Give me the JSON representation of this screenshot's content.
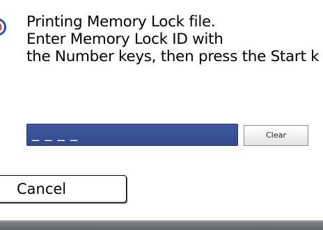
{
  "dialog": {
    "message_lines": [
      "Printing Memory Lock file.",
      "Enter Memory Lock ID with",
      "the Number keys, then press the Start k"
    ]
  },
  "id_field": {
    "mask": "_ _ _ _"
  },
  "buttons": {
    "clear_label": "Clear",
    "cancel_label": "Cancel"
  },
  "colors": {
    "field_blue": "#36508f",
    "bottom_bar": "#6b727a"
  },
  "icons": {
    "message_icon": "info-icon"
  }
}
